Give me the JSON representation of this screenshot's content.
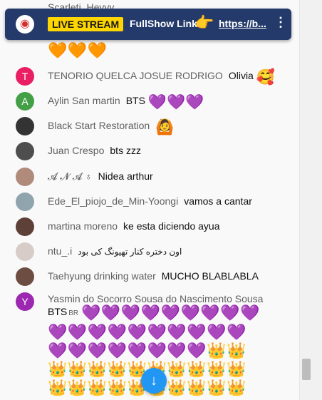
{
  "banner": {
    "live_label": "LIVE STREAM",
    "show_label": "FullShow Link",
    "point_emoji": "👉",
    "link_text": "https://b...",
    "menu_glyph": "⋮",
    "logo_glyph": "◉"
  },
  "partial_top": {
    "author": "Scarleti_Heyvy",
    "emojis": "🧡🧡🧡"
  },
  "messages": [
    {
      "author": "TENORIO QUELCA JOSUE RODRIGO",
      "text": "Olivia",
      "emoji": "🥰",
      "avatar_letter": "T",
      "avatar_color": "#e91e63"
    },
    {
      "author": "Aylin San martin",
      "text": "BTS",
      "emoji": "💜💜💜",
      "avatar_letter": "A",
      "avatar_color": "#43a047"
    },
    {
      "author": "Black Start Restoration",
      "text": "",
      "emoji": "🙆",
      "avatar_color": "#333333"
    },
    {
      "author": "Juan Crespo",
      "text": "bts zzz",
      "emoji": "",
      "avatar_color": "#4e4e4e"
    },
    {
      "author": "𝓐 𝓝 𝓐 ♁",
      "text": "Nidea arthur",
      "emoji": "",
      "avatar_color": "#b08a7a"
    },
    {
      "author": "Ede_El_piojo_de_Min-Yoongi",
      "text": "vamos a cantar",
      "emoji": "",
      "avatar_color": "#90a4ae"
    },
    {
      "author": "martina moreno",
      "text": "ke esta diciendo ayua",
      "emoji": "",
      "avatar_color": "#5d4037"
    },
    {
      "author": "ntu_.i",
      "text": "اون دختره کنار تهیونگ کی بود",
      "emoji": "",
      "avatar_color": "#d7ccc8"
    },
    {
      "author": "Taehyung drinking water",
      "text": "MUCHO BLABLABLA",
      "emoji": "",
      "avatar_color": "#6d4c41"
    }
  ],
  "last_message": {
    "author": "Yasmin do Socorro Sousa do Nascimento Sousa",
    "text": "BTS",
    "badge": "BR",
    "avatar_letter": "Y",
    "avatar_color": "#9c27b0",
    "emoji_line1": "💜💜💜💜💜💜💜💜💜",
    "emoji_line2": "💜💜💜💜💜💜💜💜💜💜",
    "emoji_line3": "💜💜💜💜💜💜💜💜👑👑",
    "emoji_line4": "👑👑👑👑👑👑👑👑👑👑",
    "emoji_line5": "👑👑👑👑👑👑👑👑👑👑"
  },
  "fab_glyph": "↓"
}
